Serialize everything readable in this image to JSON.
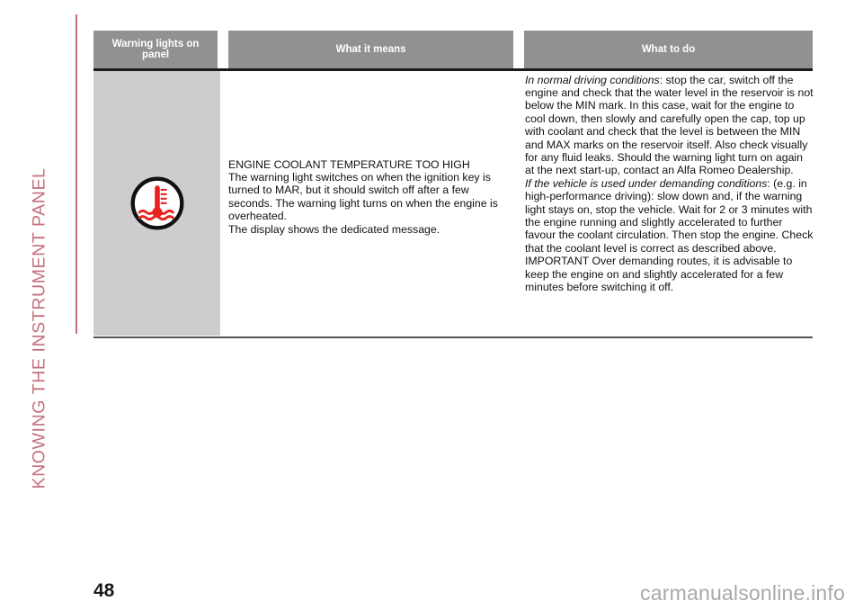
{
  "chapter": {
    "title": "KNOWING THE INSTRUMENT PANEL",
    "accent_color": "#c4707c"
  },
  "table": {
    "headers": [
      "Warning lights on panel",
      "What it means",
      "What to do"
    ],
    "header_bg": "#919191",
    "header_text_color": "#ffffff",
    "icon_cell_bg": "#cdcdcd",
    "rows": [
      {
        "icon": {
          "name": "engine-coolant-temperature-warning-icon",
          "description": "Thermometer over wavy water lines inside a circle",
          "color": "#e8231f",
          "ring_color": "#111111"
        },
        "what_it_means": {
          "title": "ENGINE COOLANT TEMPERATURE TOO HIGH",
          "body": "The warning light switches on when the ignition key is turned to MAR, but it should switch off after a few seconds. The warning light turns on when the engine is overheated.",
          "extra": "The display shows the dedicated message."
        },
        "what_to_do": {
          "para1_lead": "In normal driving conditions",
          "para1_body": ": stop the car, switch off the engine and check that the water level in the reservoir is not below the MIN mark. In this case, wait for the engine to cool down, then slowly and carefully open the cap, top up with coolant and check that the level is between the MIN and MAX marks on the reservoir itself. Also check visually for any fluid leaks. Should the warning light turn on again at the next start-up, contact an Alfa Romeo Dealership.",
          "para2_lead": "If the vehicle is used under demanding conditions",
          "para2_body": ": (e.g. in high-performance driving): slow down and, if the warning light stays on, stop the vehicle. Wait for 2 or 3 minutes with the engine running and slightly accelerated to further favour the coolant circulation. Then stop the engine. Check that the coolant level is correct as described above.",
          "para3": "IMPORTANT Over demanding routes, it is advisable to keep the engine on and slightly accelerated for a few minutes before switching it off."
        }
      }
    ]
  },
  "footer": {
    "page_number": "48",
    "watermark": "carmanualsonline.info"
  }
}
